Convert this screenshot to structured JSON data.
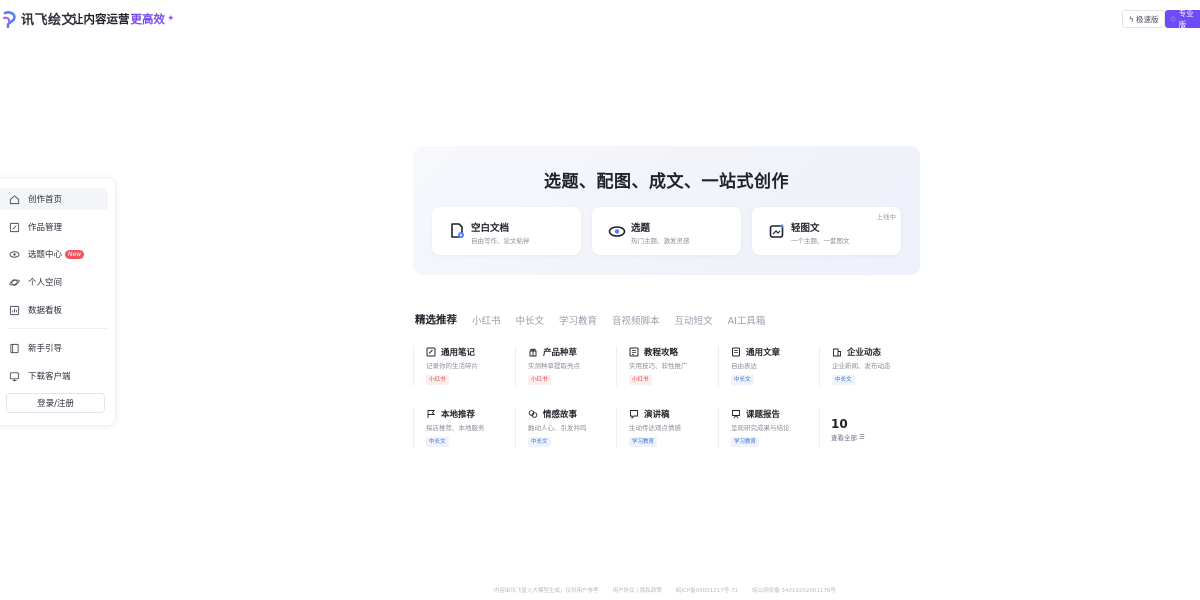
{
  "header": {
    "logo_text": "讯飞绘文",
    "slogan_prefix": "让内容运营",
    "slogan_highlight": "更高效",
    "lite_label": "极速版",
    "pro_label": "专业版",
    "colors": {
      "accent": "#6d4bf5",
      "highlight": "#7a4cf2"
    }
  },
  "sidebar": {
    "items": [
      {
        "label": "创作首页",
        "icon": "home-icon",
        "active": true
      },
      {
        "label": "作品管理",
        "icon": "edit-doc-icon"
      },
      {
        "label": "选题中心",
        "icon": "eye-icon",
        "badge": "New"
      },
      {
        "label": "个人空间",
        "icon": "planet-icon"
      },
      {
        "label": "数据看板",
        "icon": "chart-board-icon"
      }
    ],
    "secondary": [
      {
        "label": "新手引导",
        "icon": "book-icon"
      },
      {
        "label": "下载客户端",
        "icon": "monitor-icon"
      }
    ],
    "login_label": "登录/注册"
  },
  "hero": {
    "title": "选题、配图、成文、一站式创作",
    "cards": [
      {
        "title": "空白文档",
        "subtitle": "自由写作、论文粘伴",
        "icon": "blank-doc-icon"
      },
      {
        "title": "选题",
        "subtitle": "热门主题、激发灵感",
        "icon": "eye-icon"
      },
      {
        "title": "轻图文",
        "subtitle": "一个主题、一套图文",
        "icon": "image-text-icon",
        "tag": "上线中"
      }
    ]
  },
  "tabs": [
    "精选推荐",
    "小红书",
    "中长文",
    "学习教育",
    "音视频脚本",
    "互动短文",
    "AI工具箱"
  ],
  "templates": [
    {
      "title": "通用笔记",
      "desc": "记录你的生活碎片",
      "tag": "小红书",
      "tag_color": "red",
      "icon": "note-icon"
    },
    {
      "title": "产品种草",
      "desc": "实测种草提取亮点",
      "tag": "小红书",
      "tag_color": "red",
      "icon": "gift-icon"
    },
    {
      "title": "教程攻略",
      "desc": "实用技巧、软性推广",
      "tag": "小红书",
      "tag_color": "red",
      "icon": "tutorial-icon"
    },
    {
      "title": "通用文章",
      "desc": "自由表达",
      "tag": "中长文",
      "tag_color": "blue",
      "icon": "article-icon"
    },
    {
      "title": "企业动态",
      "desc": "企业新闻、发布动态",
      "tag": "中长文",
      "tag_color": "blue",
      "icon": "building-icon"
    },
    {
      "title": "本地推荐",
      "desc": "探店推荐、本地服务",
      "tag": "中长文",
      "tag_color": "blue",
      "icon": "flag-icon"
    },
    {
      "title": "情感故事",
      "desc": "触动人心、引发共鸣",
      "tag": "中长文",
      "tag_color": "blue",
      "icon": "story-icon"
    },
    {
      "title": "演讲稿",
      "desc": "生动传达观点情感",
      "tag": "学习教育",
      "tag_color": "blue",
      "icon": "speech-icon"
    },
    {
      "title": "课题报告",
      "desc": "呈现研究成果与结论",
      "tag": "学习教育",
      "tag_color": "blue",
      "icon": "report-icon"
    }
  ],
  "more": {
    "count": "10",
    "label": "查看全部"
  },
  "footer": {
    "items": [
      "内容由讯飞星火大模型生成，仅供用户参考",
      "用户协议 | 隐私政策",
      "皖ICP备05001217号-71",
      "皖公网安备 34019202001176号"
    ]
  }
}
